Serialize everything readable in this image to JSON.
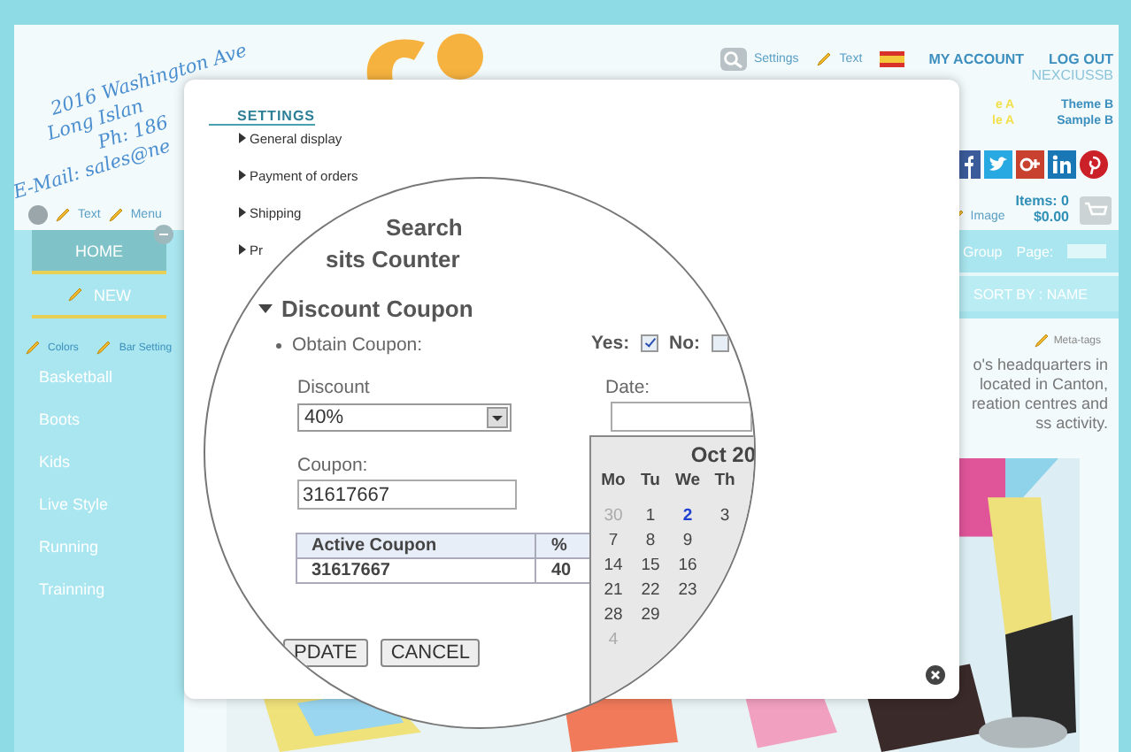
{
  "header": {
    "address_lines": [
      "2016 Washington Ave",
      "Long Islan",
      "Ph: 186",
      "E-Mail: sales@ne"
    ],
    "tools": [
      {
        "kind": "search",
        "label": "Settings"
      },
      {
        "kind": "pencil",
        "label": "Text"
      }
    ],
    "account_links": [
      "MY ACCOUNT",
      "LOG OUT"
    ],
    "username": "NEXCIUSSB",
    "themes": [
      {
        "name": "e A",
        "sample": "le A",
        "selected": true
      },
      {
        "name": "Theme B",
        "sample": "Sample B",
        "selected": false
      }
    ],
    "edit_links": [
      "Text",
      "Menu"
    ],
    "image_link": "Image",
    "cart": {
      "items": "Items: 0",
      "total": "$0.00"
    }
  },
  "nav": {
    "items": [
      {
        "label": "HOME",
        "selected": true
      },
      {
        "label": "NEW",
        "selected": false
      }
    ],
    "group": "Group",
    "page_label": "Page:",
    "sort": "SORT BY : NAME"
  },
  "sidebar": {
    "tools": [
      "Colors",
      "Bar Setting"
    ],
    "items": [
      "Basketball",
      "Boots",
      "Kids",
      "Live Style",
      "Running",
      "Trainning"
    ]
  },
  "content": {
    "meta_link": "Meta-tags",
    "text_lines": [
      "o's headquarters in",
      "located in Canton,",
      "reation centres and",
      "ss activity."
    ]
  },
  "modal": {
    "title": "SETTINGS",
    "sections": [
      "General display",
      "Payment of orders",
      "Shipping",
      "Pr"
    ]
  },
  "lens": {
    "section_stubs": [
      "Search",
      "sits Counter"
    ],
    "open_section": {
      "label": "Discount Coupon",
      "expanded": true
    },
    "obtain_label": "Obtain Coupon:",
    "yes": {
      "label": "Yes:",
      "checked": true
    },
    "no": {
      "label": "No:",
      "checked": false
    },
    "discount": {
      "label": "Discount",
      "value": "40%"
    },
    "date": {
      "label": "Date:"
    },
    "coupon": {
      "label": "Coupon:",
      "value": "31617667"
    },
    "table": {
      "columns": [
        "Active Coupon",
        "%"
      ],
      "rows": [
        [
          "31617667",
          "40"
        ]
      ]
    },
    "buttons": [
      "PDATE",
      "CANCEL"
    ],
    "calendar": {
      "title": "Oct 20",
      "weekdays": [
        "Mo",
        "Tu",
        "We",
        "Th"
      ],
      "weeks": [
        [
          {
            "day": "30",
            "other_month": true,
            "selected": false
          },
          {
            "day": "1",
            "other_month": false,
            "selected": false
          },
          {
            "day": "2",
            "other_month": false,
            "selected": true
          },
          {
            "day": "3",
            "other_month": false,
            "selected": false
          }
        ],
        [
          {
            "day": "7",
            "other_month": false,
            "selected": false
          },
          {
            "day": "8",
            "other_month": false,
            "selected": false
          },
          {
            "day": "9",
            "other_month": false,
            "selected": false
          }
        ],
        [
          {
            "day": "14",
            "other_month": false,
            "selected": false
          },
          {
            "day": "15",
            "other_month": false,
            "selected": false
          },
          {
            "day": "16",
            "other_month": false,
            "selected": false
          }
        ],
        [
          {
            "day": "21",
            "other_month": false,
            "selected": false
          },
          {
            "day": "22",
            "other_month": false,
            "selected": false
          },
          {
            "day": "23",
            "other_month": false,
            "selected": false
          }
        ],
        [
          {
            "day": "28",
            "other_month": false,
            "selected": false
          },
          {
            "day": "29",
            "other_month": false,
            "selected": false
          }
        ],
        [
          {
            "day": "4",
            "other_month": true,
            "selected": false
          }
        ]
      ]
    }
  }
}
